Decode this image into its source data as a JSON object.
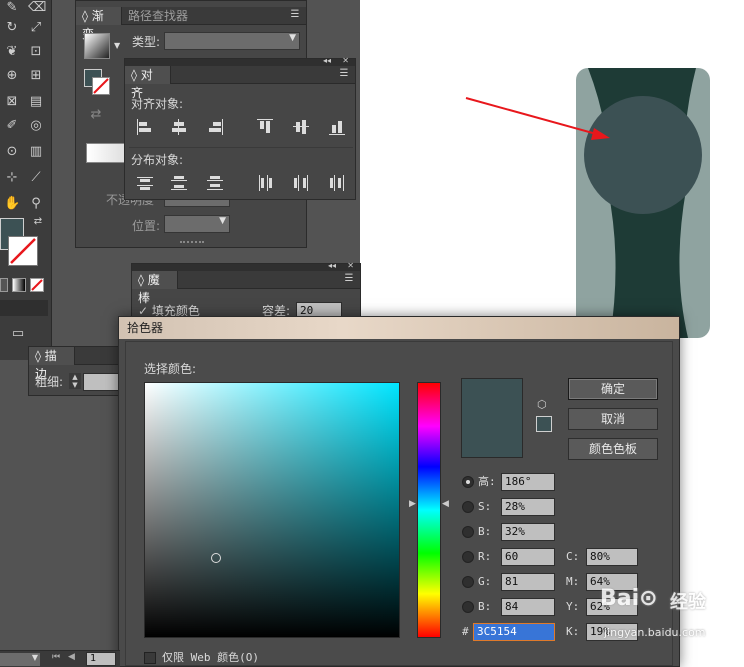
{
  "toolbar": {
    "icons": [
      "pen-tool-icon",
      "rotate-icon",
      "scale-icon",
      "warp-icon",
      "free-transform-icon",
      "shape-builder-icon",
      "perspective-icon",
      "mesh-icon",
      "gradient-icon",
      "eyedropper-icon",
      "blend-icon",
      "symbol-sprayer-icon",
      "column-graph-icon",
      "artboard-icon",
      "slice-icon",
      "hand-icon",
      "zoom-icon"
    ],
    "fill_color": "#3c5154"
  },
  "gradient_panel": {
    "tabs": [
      "渐变",
      "路径查找器"
    ],
    "type_label": "类型:",
    "location_label": "位置:",
    "opacity_label_fragment": "不透明度"
  },
  "align_panel": {
    "tab": "对齐",
    "align_objects_label": "对齐对象:",
    "distribute_objects_label": "分布对象:"
  },
  "magic_wand_panel": {
    "tab": "魔棒",
    "fill_color_option": "填充颜色",
    "tolerance_label": "容差:",
    "tolerance_value": "20"
  },
  "stroke_panel": {
    "tab": "描边",
    "weight_label": "粗细:"
  },
  "color_picker": {
    "title": "拾色器",
    "select_color_label": "选择颜色:",
    "buttons": {
      "ok": "确定",
      "cancel": "取消",
      "swatches": "颜色色板"
    },
    "fields": {
      "H": {
        "label": "高:",
        "value": "186°"
      },
      "S": {
        "label": "S:",
        "value": "28%"
      },
      "B": {
        "label": "B:",
        "value": "32%"
      },
      "R": {
        "label": "R:",
        "value": "60"
      },
      "G": {
        "label": "G:",
        "value": "81"
      },
      "Bl": {
        "label": "B:",
        "value": "84"
      },
      "C": {
        "label": "C:",
        "value": "80%"
      },
      "M": {
        "label": "M:",
        "value": "64%"
      },
      "Y": {
        "label": "Y:",
        "value": "62%"
      },
      "K": {
        "label": "K:",
        "value": "19%"
      }
    },
    "hex_label": "#",
    "hex_value": "3C5154",
    "web_only_label": "仅限 Web 颜色(O)",
    "selected_color": "#3c5154"
  },
  "artwork": {
    "card_color": "#8fa3a0",
    "shape_color": "#1e3b36",
    "circle_color": "#3c5154",
    "arrow_color": "#e8171c"
  },
  "statusbar": {
    "page_number": "1"
  },
  "watermark": "Baidu 经验 jingyan.baidu.com"
}
